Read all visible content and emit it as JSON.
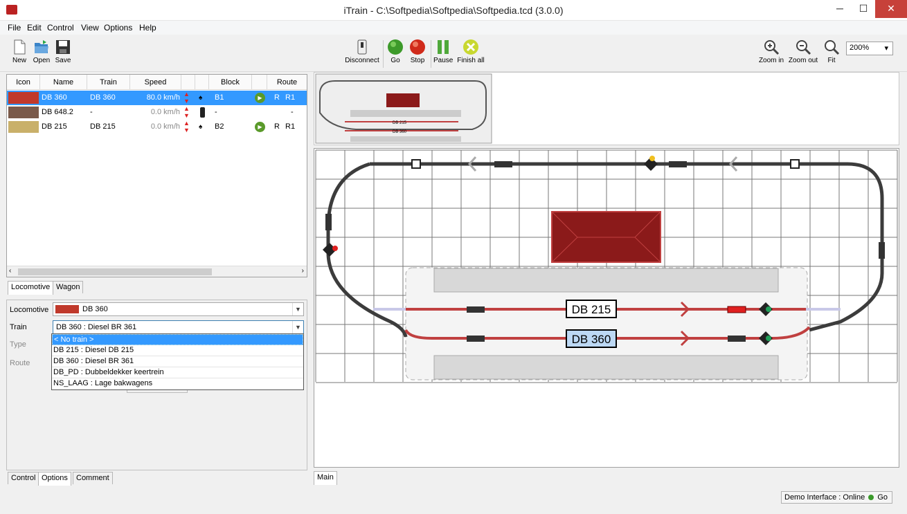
{
  "window": {
    "title": "iTrain - C:\\Softpedia\\Softpedia\\Softpedia.tcd (3.0.0)",
    "minimize": "─",
    "maximize": "☐",
    "close": "✕"
  },
  "menu": [
    "File",
    "Edit",
    "Control",
    "View",
    "Options",
    "Help"
  ],
  "toolbar": {
    "new": "New",
    "open": "Open",
    "save": "Save",
    "disconnect": "Disconnect",
    "go": "Go",
    "stop": "Stop",
    "pause": "Pause",
    "finish_all": "Finish all",
    "zoom_in": "Zoom in",
    "zoom_out": "Zoom out",
    "fit": "Fit",
    "zoom_value": "200%"
  },
  "loco_table": {
    "headers": [
      "Icon",
      "Name",
      "Train",
      "Speed",
      "",
      "",
      "Block",
      "",
      "Route"
    ],
    "rows": [
      {
        "name": "DB 360",
        "train": "DB 360",
        "speed": "80.0 km/h",
        "block": "B1",
        "route_dir": "R",
        "route": "R1",
        "selected": true
      },
      {
        "name": "DB 648.2",
        "train": "-",
        "speed": "0.0 km/h",
        "block": "-",
        "route_dir": "",
        "route": "-",
        "selected": false
      },
      {
        "name": "DB 215",
        "train": "DB 215",
        "speed": "0.0 km/h",
        "block": "B2",
        "route_dir": "R",
        "route": "R1",
        "selected": false
      }
    ]
  },
  "upper_tabs": [
    "Locomotive",
    "Wagon"
  ],
  "options": {
    "locomotive_label": "Locomotive",
    "locomotive_value": "DB 360",
    "train_label": "Train",
    "train_value": "DB 360 : Diesel BR 361",
    "type_label": "Type",
    "route_label": "Route",
    "train_options": [
      "< No train >",
      "DB 215 : Diesel DB 215",
      "DB 360 : Diesel BR 361",
      "DB_PD : Dubbeldekker keertrein",
      "NS_LAAG : Lage bakwagens"
    ]
  },
  "lower_tabs": [
    "Control",
    "Options",
    "Comment"
  ],
  "main_tab": "Main",
  "layout": {
    "train_labels": [
      "DB 215",
      "DB 360"
    ],
    "overview_labels": [
      "DB 215",
      "DB 360"
    ]
  },
  "status": {
    "interface": "Demo Interface :",
    "state": "Online",
    "power": "Go"
  },
  "colors": {
    "track": "#3c3c3c",
    "active_track": "#c04040",
    "station": "#8b1a1a",
    "selection": "#3399ff",
    "signal_green": "#21a05a"
  }
}
